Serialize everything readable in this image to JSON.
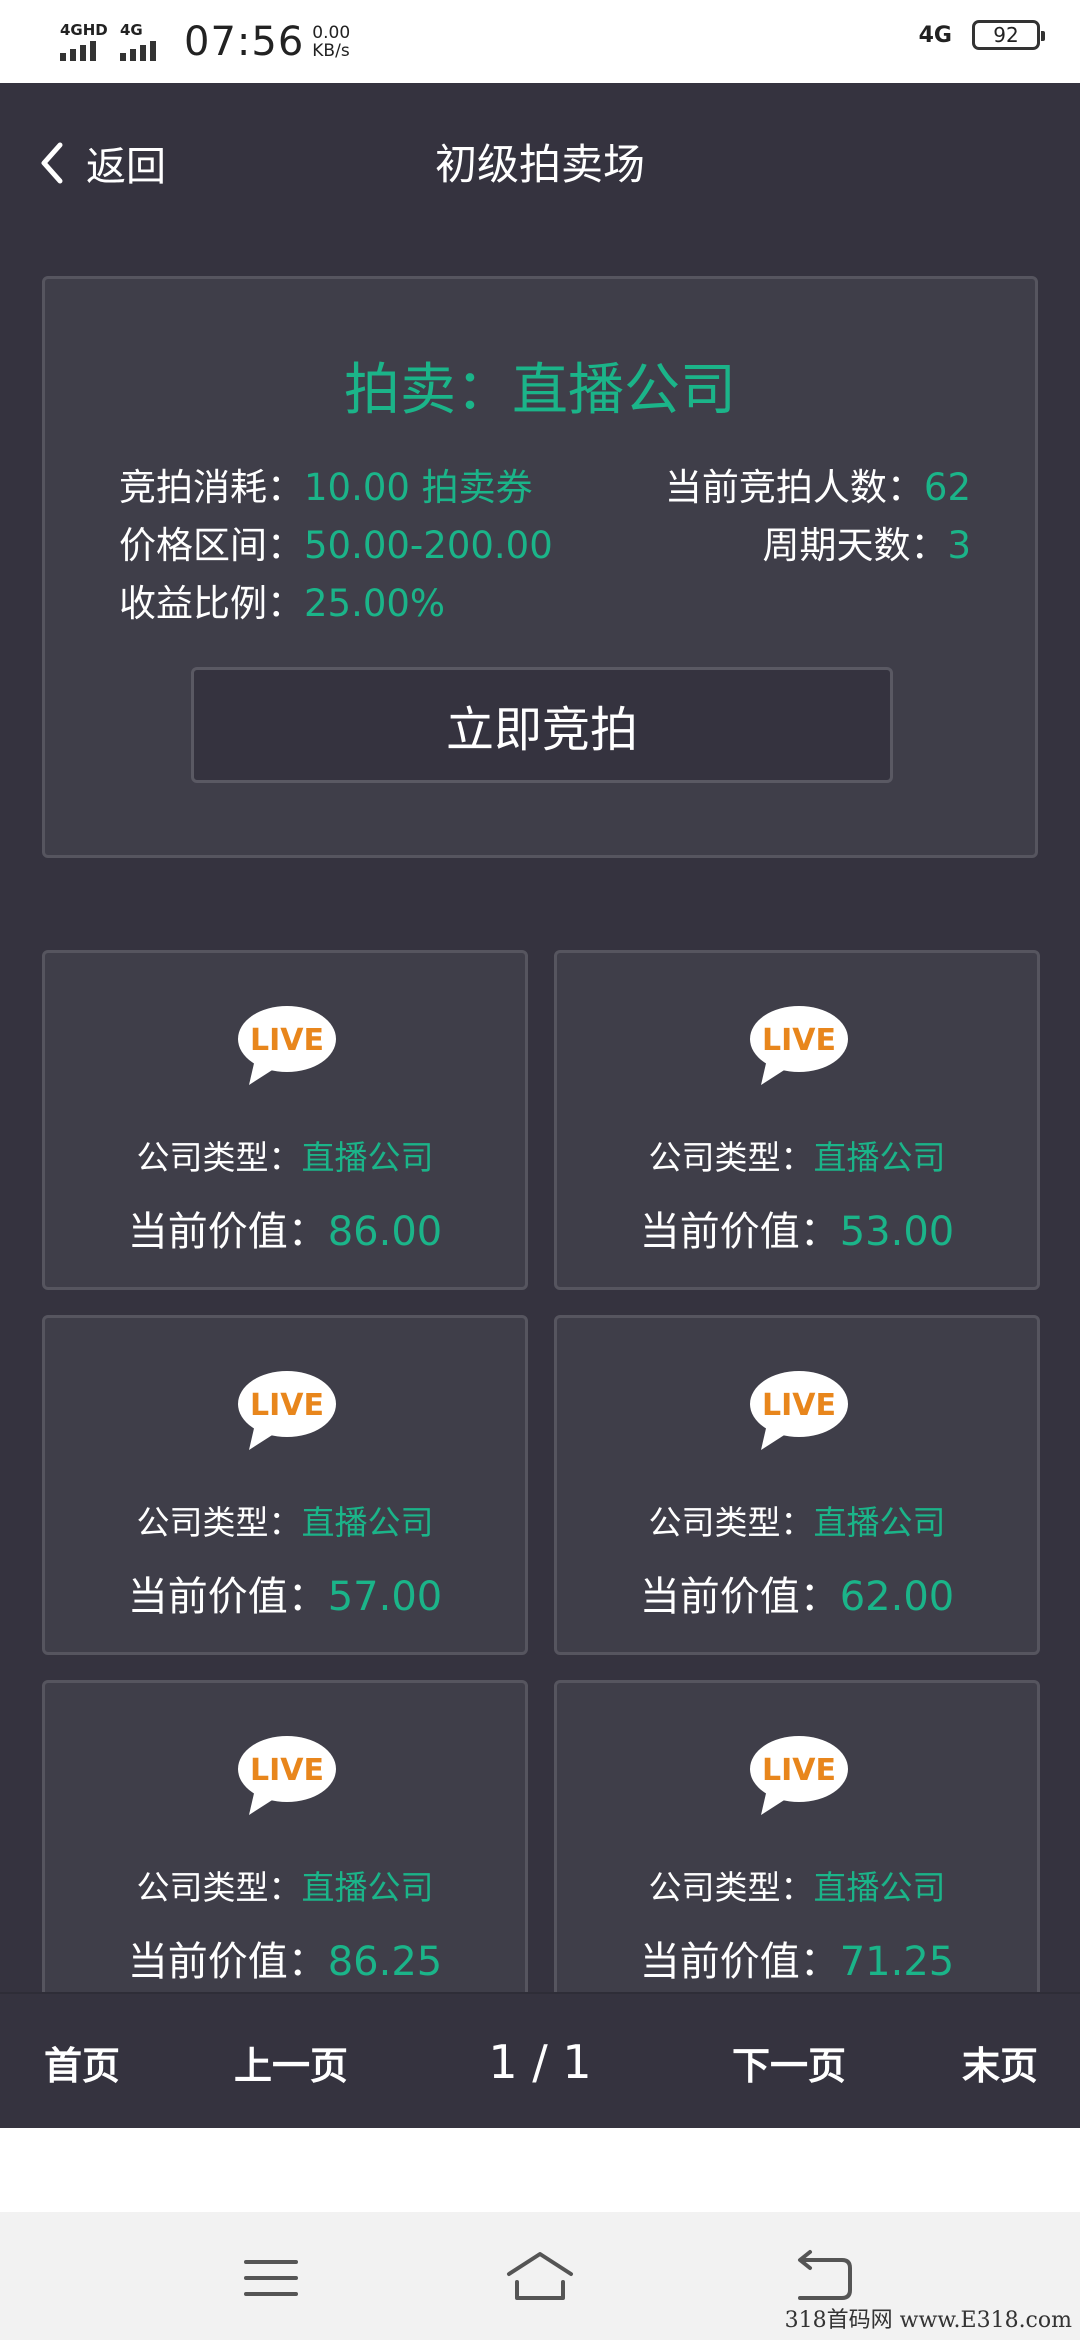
{
  "status_bar": {
    "sim1_type": "4GHD",
    "sim2_type": "4G",
    "time": "07:56",
    "speed_value": "0.00",
    "speed_unit": "KB/s",
    "right_network": "4G",
    "battery": "92"
  },
  "header": {
    "back_label": "返回",
    "title": "初级拍卖场"
  },
  "auction": {
    "title": "拍卖：直播公司",
    "cost_label": "竞拍消耗：",
    "cost_value": "10.00 拍卖券",
    "bidders_label": "当前竞拍人数：",
    "bidders_value": "62",
    "price_range_label": "价格区间：",
    "price_range_value": "50.00-200.00",
    "period_label": "周期天数：",
    "period_value": "3",
    "ratio_label": "收益比例：",
    "ratio_value": "25.00%",
    "bid_button": "立即竞拍"
  },
  "company_cards": [
    {
      "type_label": "公司类型：",
      "type_value": "直播公司",
      "value_label": "当前价值：",
      "value": "86.00"
    },
    {
      "type_label": "公司类型：",
      "type_value": "直播公司",
      "value_label": "当前价值：",
      "value": "53.00"
    },
    {
      "type_label": "公司类型：",
      "type_value": "直播公司",
      "value_label": "当前价值：",
      "value": "57.00"
    },
    {
      "type_label": "公司类型：",
      "type_value": "直播公司",
      "value_label": "当前价值：",
      "value": "62.00"
    },
    {
      "type_label": "公司类型：",
      "type_value": "直播公司",
      "value_label": "当前价值：",
      "value": "86.25"
    },
    {
      "type_label": "公司类型：",
      "type_value": "直播公司",
      "value_label": "当前价值：",
      "value": "71.25"
    }
  ],
  "pagination": {
    "first": "首页",
    "prev": "上一页",
    "info": "1 / 1",
    "next": "下一页",
    "last": "末页"
  },
  "watermark": "318首码网 www.E318.com",
  "colors": {
    "accent": "#1bb489",
    "background": "#35333f",
    "card": "#3f3e49",
    "live_icon": "#e8861c"
  }
}
